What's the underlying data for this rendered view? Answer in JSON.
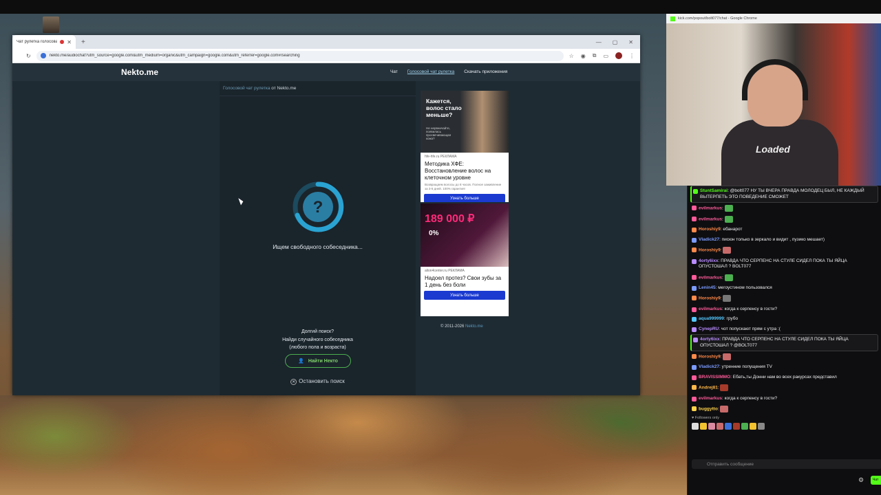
{
  "browser": {
    "tab_title": "Чат рулетка голосовая —",
    "url": "nekto.me/audiochat?utm_source=google.com&utm_medium=organic&utm_campaign=google.com&utm_referrer=google.com#/searching"
  },
  "site": {
    "logo": "Nekto.me",
    "nav": [
      "Чат",
      "Голосовой чат рулетка",
      "Скачать приложения"
    ],
    "breadcrumb_link": "Голосовой чат рулетка",
    "breadcrumb_rest": " от Nekto.me",
    "loader_symbol": "?",
    "status": "Ищем свободного собеседника...",
    "long_search_lines": [
      "Долгий поиск?",
      "Найди случайного собеседника",
      "(любого пола и возраста)"
    ],
    "find_button": "Найти Некто",
    "stop_label": "Остановить поиск",
    "copyright_prefix": "© 2011-2026 ",
    "copyright_link": "Nekto.me"
  },
  "ads": [
    {
      "headline": "Кажется, волос стало меньше?",
      "sub": "Не нервничайте, появилась просвечивающая кожа?",
      "source": "hfe-hfe.ru  РЕКЛАМА",
      "title": "Методика ХФЕ: Восстановление волос на клеточном уровне",
      "small": "Возвращаем волосы до 8 часов. Полное заживление за 3-5 дней. 100% гарантия!",
      "button": "Узнать больше"
    },
    {
      "price": "189 000 ₽",
      "percent": "0%",
      "source": "alion4center.ru  РЕКЛАМА",
      "title": "Надоел протез? Свои зубы за 1 день без боли",
      "button": "Узнать больше"
    }
  ],
  "stream": {
    "window_title": "kick.com/popout/bolt077/chat - Google Chrome",
    "shirt_text": "Loaded"
  },
  "chat": {
    "messages": [
      {
        "name": "StuntSamirai",
        "text": "@bolt077 НУ ТЫ ВЧЕРА ПРАВДА МОЛОДЕЦ БЫЛ, НЕ КАЖДЫЙ ВЫТЕРПЕТЬ ЭТО ПОВЕДЕНИЕ СМОЖЕТ",
        "color": "#53fc18",
        "highlight": true
      },
      {
        "name": "evilmarkus",
        "text": "",
        "color": "#ff5b9a",
        "emote": "#4caf50"
      },
      {
        "name": "evilmarkus",
        "text": "",
        "color": "#ff5b9a",
        "emote": "#4caf50"
      },
      {
        "name": "Horoshiy9",
        "text": "ебанарот",
        "color": "#ff8a4a"
      },
      {
        "name": "Vladick27",
        "text": "писюн только в зеркало и видит , пузико мешает)",
        "color": "#7b9bff"
      },
      {
        "name": "Horoshiy9",
        "text": "",
        "color": "#ff8a4a",
        "emote": "#c86a6a"
      },
      {
        "name": "4orty6ixx",
        "text": "ПРАВДА ЧТО СЕРПЕНС НА СТУЛЕ СИДЕЛ ПОКА ТЫ ЯЙЦА ОПУСТОШАЛ ? BOLT077",
        "color": "#b98cff"
      },
      {
        "name": "evilmarkus",
        "text": "",
        "color": "#ff5b9a",
        "emote": "#4caf50"
      },
      {
        "name": "Lenin45",
        "text": "мегоустином пользовался",
        "color": "#7b9bff"
      },
      {
        "name": "Horoshiy9",
        "text": "",
        "color": "#ff8a4a",
        "emote": "#777"
      },
      {
        "name": "evilmarkus",
        "text": "когда к серпенсу в гости?",
        "color": "#ff5b9a"
      },
      {
        "name": "aqua999999",
        "text": "грубо",
        "color": "#53c8ff"
      },
      {
        "name": "CynepRU",
        "text": "чот попускают прям с утра :(",
        "color": "#b98cff"
      },
      {
        "name": "4orty6ixx",
        "text": "ПРАВДА ЧТО СЕРПЕНС НА СТУЛЕ СИДЕЛ ПОКА ТЫ ЯЙЦА ОПУСТОШАЛ ? @BOLT077",
        "color": "#b98cff",
        "highlight": true
      },
      {
        "name": "Horoshiy9",
        "text": "",
        "color": "#ff8a4a",
        "emote": "#c86a6a"
      },
      {
        "name": "Vladick27",
        "text": "утренние попущения TV",
        "color": "#7b9bff"
      },
      {
        "name": "BRAVISSIMMO",
        "text": "Ебать,ты Донни нам во всех ракурсах представил",
        "color": "#ff5b9a"
      },
      {
        "name": "Andrej81",
        "text": "",
        "color": "#ffb84a",
        "emote": "#a53a2a"
      },
      {
        "name": "evilmarkus",
        "text": "когда к серпенсу в гости?",
        "color": "#ff5b9a"
      },
      {
        "name": "buggytto",
        "text": "",
        "color": "#ffd34a",
        "emote": "#c86a6a"
      }
    ],
    "followers_only": "♥ Followers only",
    "input_placeholder": "Отправить сообщение",
    "send_label": "Чат"
  }
}
